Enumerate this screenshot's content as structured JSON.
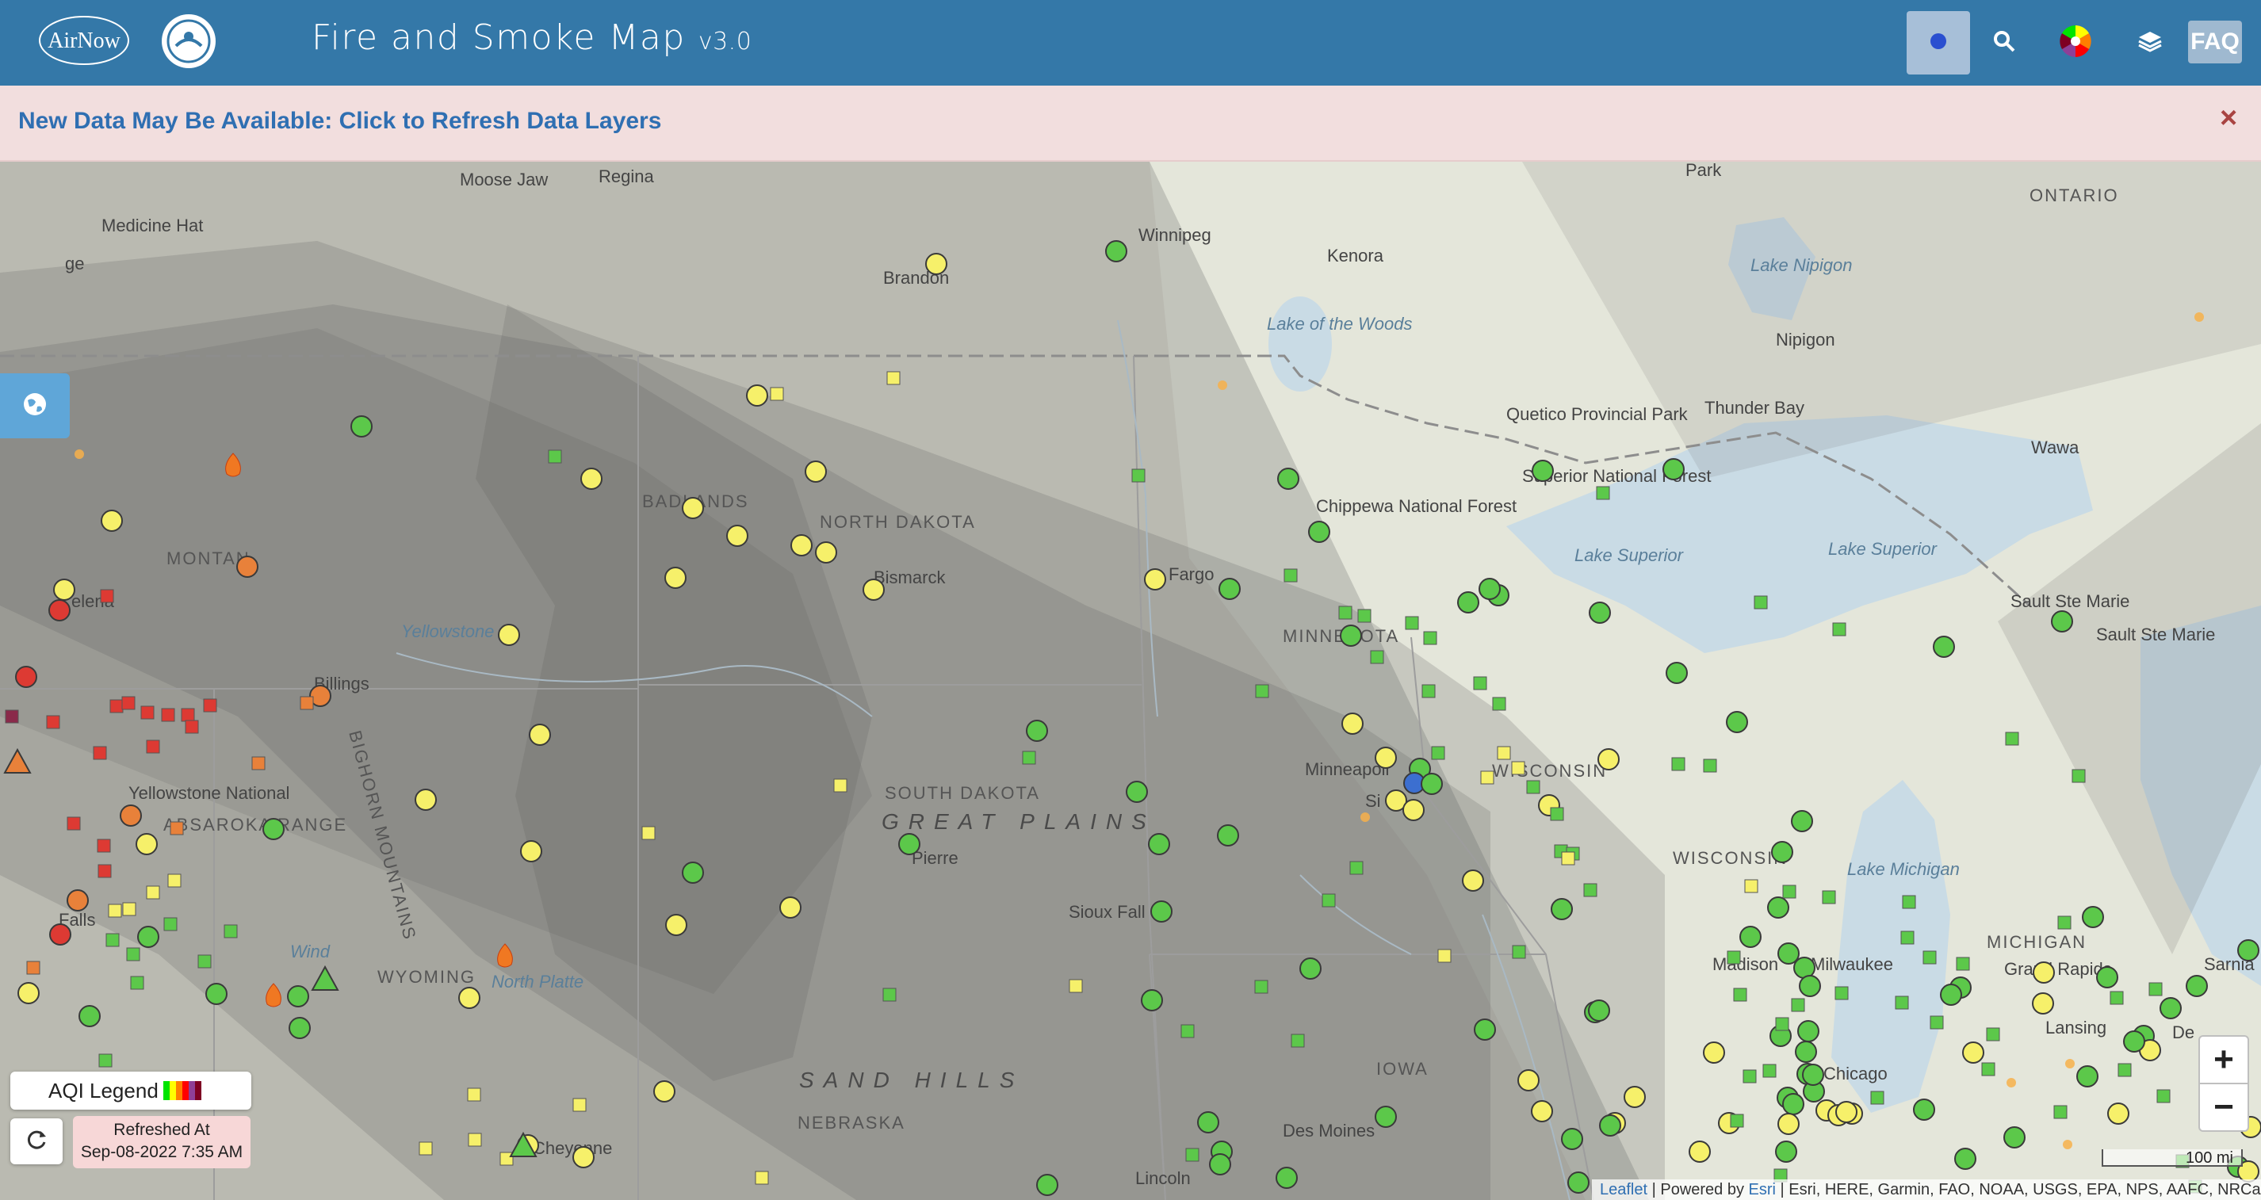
{
  "header": {
    "brand": "AirNow",
    "title": "Fire and Smoke Map",
    "version": "v3.0",
    "faq_label": "FAQ",
    "icons": [
      "location-dot-icon",
      "search-icon",
      "aqi-color-wheel-icon",
      "layers-icon"
    ]
  },
  "banner": {
    "text": "New Data May Be Available: Click to Refresh Data Layers",
    "close": "×"
  },
  "legend": {
    "label": "AQI Legend",
    "colors": [
      "#00e400",
      "#ffff00",
      "#ff7e00",
      "#ff0000",
      "#8f3f97",
      "#7e0023"
    ]
  },
  "refresh": {
    "line1": "Refreshed At",
    "line2": "Sep-08-2022 7:35 AM"
  },
  "zoom": {
    "in": "+",
    "out": "−"
  },
  "scale": "100 mi",
  "attribution": {
    "leaflet": "Leaflet",
    "powered": " | Powered by ",
    "esri": "Esri",
    "rest": " | Esri, HERE, Garmin, FAO, NOAA, USGS, EPA, NPS, AAFC, NRCan"
  },
  "map_labels": {
    "moose_jaw": "Moose Jaw",
    "regina": "Regina",
    "medicine_hat": "Medicine Hat",
    "ge": "ge",
    "brandon": "Brandon",
    "winnipeg": "Winnipeg",
    "kenora": "Kenora",
    "lake_of_the_woods": "Lake of the Woods",
    "lake_nipigon": "Lake Nipigon",
    "nipigon": "Nipigon",
    "thunder_bay": "Thunder Bay",
    "ontario": "ONTARIO",
    "park": "Park",
    "wawa": "Wawa",
    "quetico": "Quetico Provincial Park",
    "superior_nf": "Superior National Forest",
    "chippewa_nf": "Chippewa National Forest",
    "lake_superior_1": "Lake Superior",
    "lake_superior_2": "Lake Superior",
    "sault_1": "Sault Ste Marie",
    "sault_2": "Sault Ste Marie",
    "badlands": "BADLANDS",
    "north_dakota": "NORTH DAKOTA",
    "bismarck": "Bismarck",
    "fargo": "Fargo",
    "minnesota": "MINNESOTA",
    "montana": "MONTAN",
    "helena": "elena",
    "billings": "Billings",
    "yellowstone": "Yellowstone",
    "yellowstone_np": "Yellowstone National",
    "absaroka": "ABSAROKA RANGE",
    "bighorn": "BIGHORN MOUNTAINS",
    "south_dakota": "SOUTH DAKOTA",
    "great_plains": "GREAT PLAINS",
    "pierre": "Pierre",
    "sioux_falls": "Sioux Fall",
    "minneapolis": "Minneapoli",
    "wisconsin_1": "WISCONSIN",
    "wisconsin_2": "WISCONSIN",
    "lake_michigan": "Lake Michigan",
    "michigan": "MICHIGAN",
    "madison": "Madison",
    "milwaukee": "Milwaukee",
    "grand_rapids": "Grand Rapids",
    "lansing": "Lansing",
    "chicago": "Chicago",
    "sarnia": "Sarnia",
    "iowa": "IOWA",
    "des_moines": "Des Moines",
    "wyoming": "WYOMING",
    "sand_hills": "SAND HILLS",
    "nebraska": "NEBRASKA",
    "lincoln": "Lincoln",
    "cheyenne": "Cheyenne",
    "idaho_falls": "Falls",
    "north_platte": "North Platte",
    "wind": "Wind",
    "sioux_city": "Si",
    "detroit": "De"
  },
  "aqi_colors": {
    "good": "#5cc84a",
    "moderate": "#f6f06a",
    "usg": "#e8813a",
    "unhealthy": "#dd3a33",
    "very_unhealthy": "#8a2a4a",
    "sensor": "#3c6fd0"
  }
}
